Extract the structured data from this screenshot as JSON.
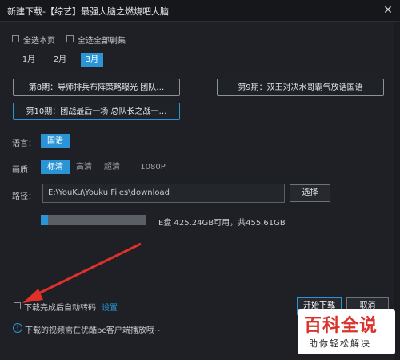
{
  "window": {
    "title": "新建下载-【综艺】最强大脑之燃烧吧大脑",
    "close_icon": "close-icon"
  },
  "selection": {
    "select_page": "全选本页",
    "select_all": "全选全部剧集"
  },
  "months": [
    {
      "label": "1月",
      "active": false
    },
    {
      "label": "2月",
      "active": false
    },
    {
      "label": "3月",
      "active": true
    }
  ],
  "episodes": [
    {
      "label": "第8期：导师排兵布阵策略曝光 团队…",
      "active": false
    },
    {
      "label": "第9期：双王对决水哥霸气放话国语",
      "active": false
    },
    {
      "label": "第10期：团战最后一场 总队长之战一…",
      "active": true
    }
  ],
  "language": {
    "label": "语言：",
    "options": [
      {
        "label": "国语",
        "active": true
      }
    ]
  },
  "quality": {
    "label": "画质：",
    "options": [
      {
        "label": "标清",
        "active": true
      },
      {
        "label": "高清",
        "active": false
      },
      {
        "label": "超清",
        "active": false
      },
      {
        "label": "1080P",
        "active": false
      }
    ]
  },
  "path": {
    "label": "路径：",
    "value": "E:\\YouKu\\Youku Files\\download",
    "choose_button": "选择"
  },
  "disk": {
    "text": "E盘 425.24GB可用，共455.61GB",
    "used_fraction": 0.067
  },
  "footer": {
    "auto_transcode": "下载完成后自动转码",
    "settings_link": "设置",
    "start_button": "开始下载",
    "cancel_button": "取消",
    "notice": "下载的视频需在优酷pc客户端播放哦~"
  },
  "watermark": {
    "title": "百科全说",
    "subtitle": "助你轻松解决"
  },
  "colors": {
    "accent": "#2a94d6",
    "background": "#1e2025",
    "arrow": "#e0302a"
  }
}
